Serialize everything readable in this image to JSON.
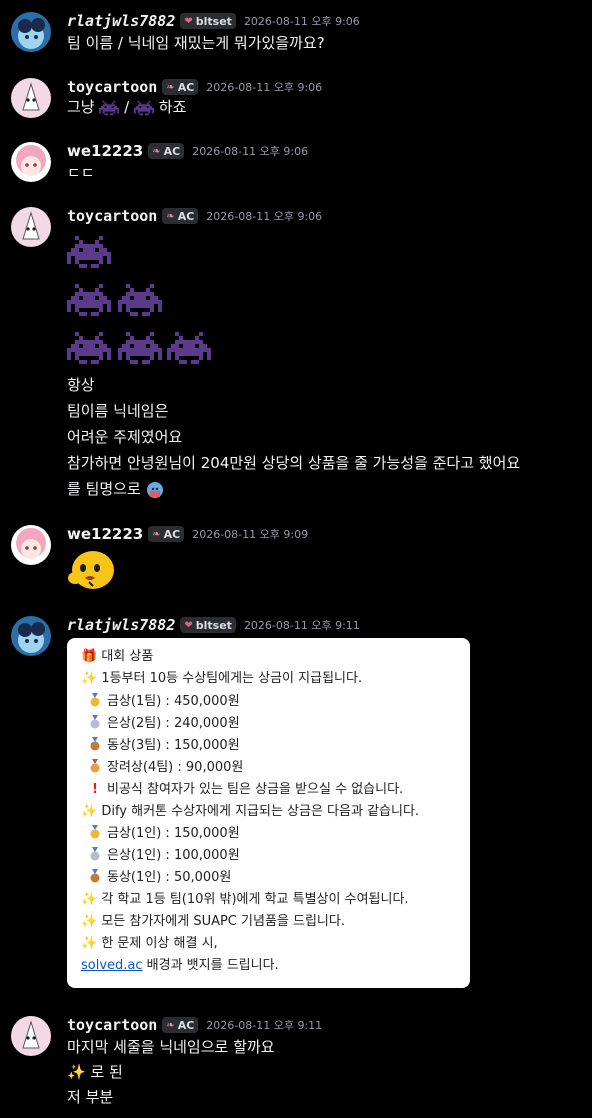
{
  "messages": [
    {
      "user": "rlatjwls7882",
      "tag": "bltset",
      "time": "2026-08-11 오후 9:06",
      "lines": [
        "팀 이름 / 닉네임 재밌는게 뭐가있을까요?"
      ]
    },
    {
      "user": "toycartoon",
      "tag": "AC",
      "time": "2026-08-11 오후 9:06",
      "lines": [
        "그냥",
        "/",
        "하죠"
      ]
    },
    {
      "user": "we12223",
      "tag": "AC",
      "time": "2026-08-11 오후 9:06",
      "lines": [
        "ㄷㄷ"
      ]
    },
    {
      "user": "toycartoon",
      "tag": "AC",
      "time": "2026-08-11 오후 9:06",
      "lines": [
        "항상",
        "팀이름 닉네임은",
        "어려운 주제였어요",
        "참가하면 안녕원님이 204만원 상당의 상품을 줄 가능성을 준다고 했어요",
        "를 팀명으로"
      ]
    },
    {
      "user": "we12223",
      "tag": "AC",
      "time": "2026-08-11 오후 9:09",
      "lines": []
    },
    {
      "user": "rlatjwls7882",
      "tag": "bltset",
      "time": "2026-08-11 오후 9:11",
      "lines": []
    },
    {
      "user": "toycartoon",
      "tag": "AC",
      "time": "2026-08-11 오후 9:11",
      "lines": [
        "마지막 세줄을 닉네임으로 할까요",
        "로 된",
        "저 부분"
      ]
    }
  ],
  "embed": {
    "lines": [
      "대회 상품",
      "1등부터 10등 수상팀에게는 상금이 지급됩니다.",
      "금상(1팀) : 450,000원",
      "은상(2팀) : 240,000원",
      "동상(3팀) : 150,000원",
      "장려상(4팀) : 90,000원",
      "비공식 참여자가 있는 팀은 상금을 받으실 수 없습니다.",
      "Dify 해커톤 수상자에게 지급되는 상금은 다음과 같습니다.",
      "금상(1인) : 150,000원",
      "은상(1인) : 100,000원",
      "동상(1인) : 50,000원",
      "각 학교 1등 팀(10위 밖)에게 학교 특별상이 수여됩니다.",
      "모든 참가자에게 SUAPC 기념품을 드립니다.",
      "한 문제 이상 해결 시,",
      "solved.ac",
      "배경과 뱃지를 드립니다."
    ]
  },
  "icons": {
    "bltset_tag": "heart-icon",
    "ac_tag": "leaf-icon",
    "invader": "pixel-invader-emoji",
    "sparkle": "sparkles-emoji",
    "gift": "gift-emoji",
    "warning": "exclamation-emoji"
  },
  "colors": {
    "background": "#000000",
    "invader": "#5b3a8c",
    "timestamp": "#949ba4",
    "link": "#0a58ca"
  }
}
